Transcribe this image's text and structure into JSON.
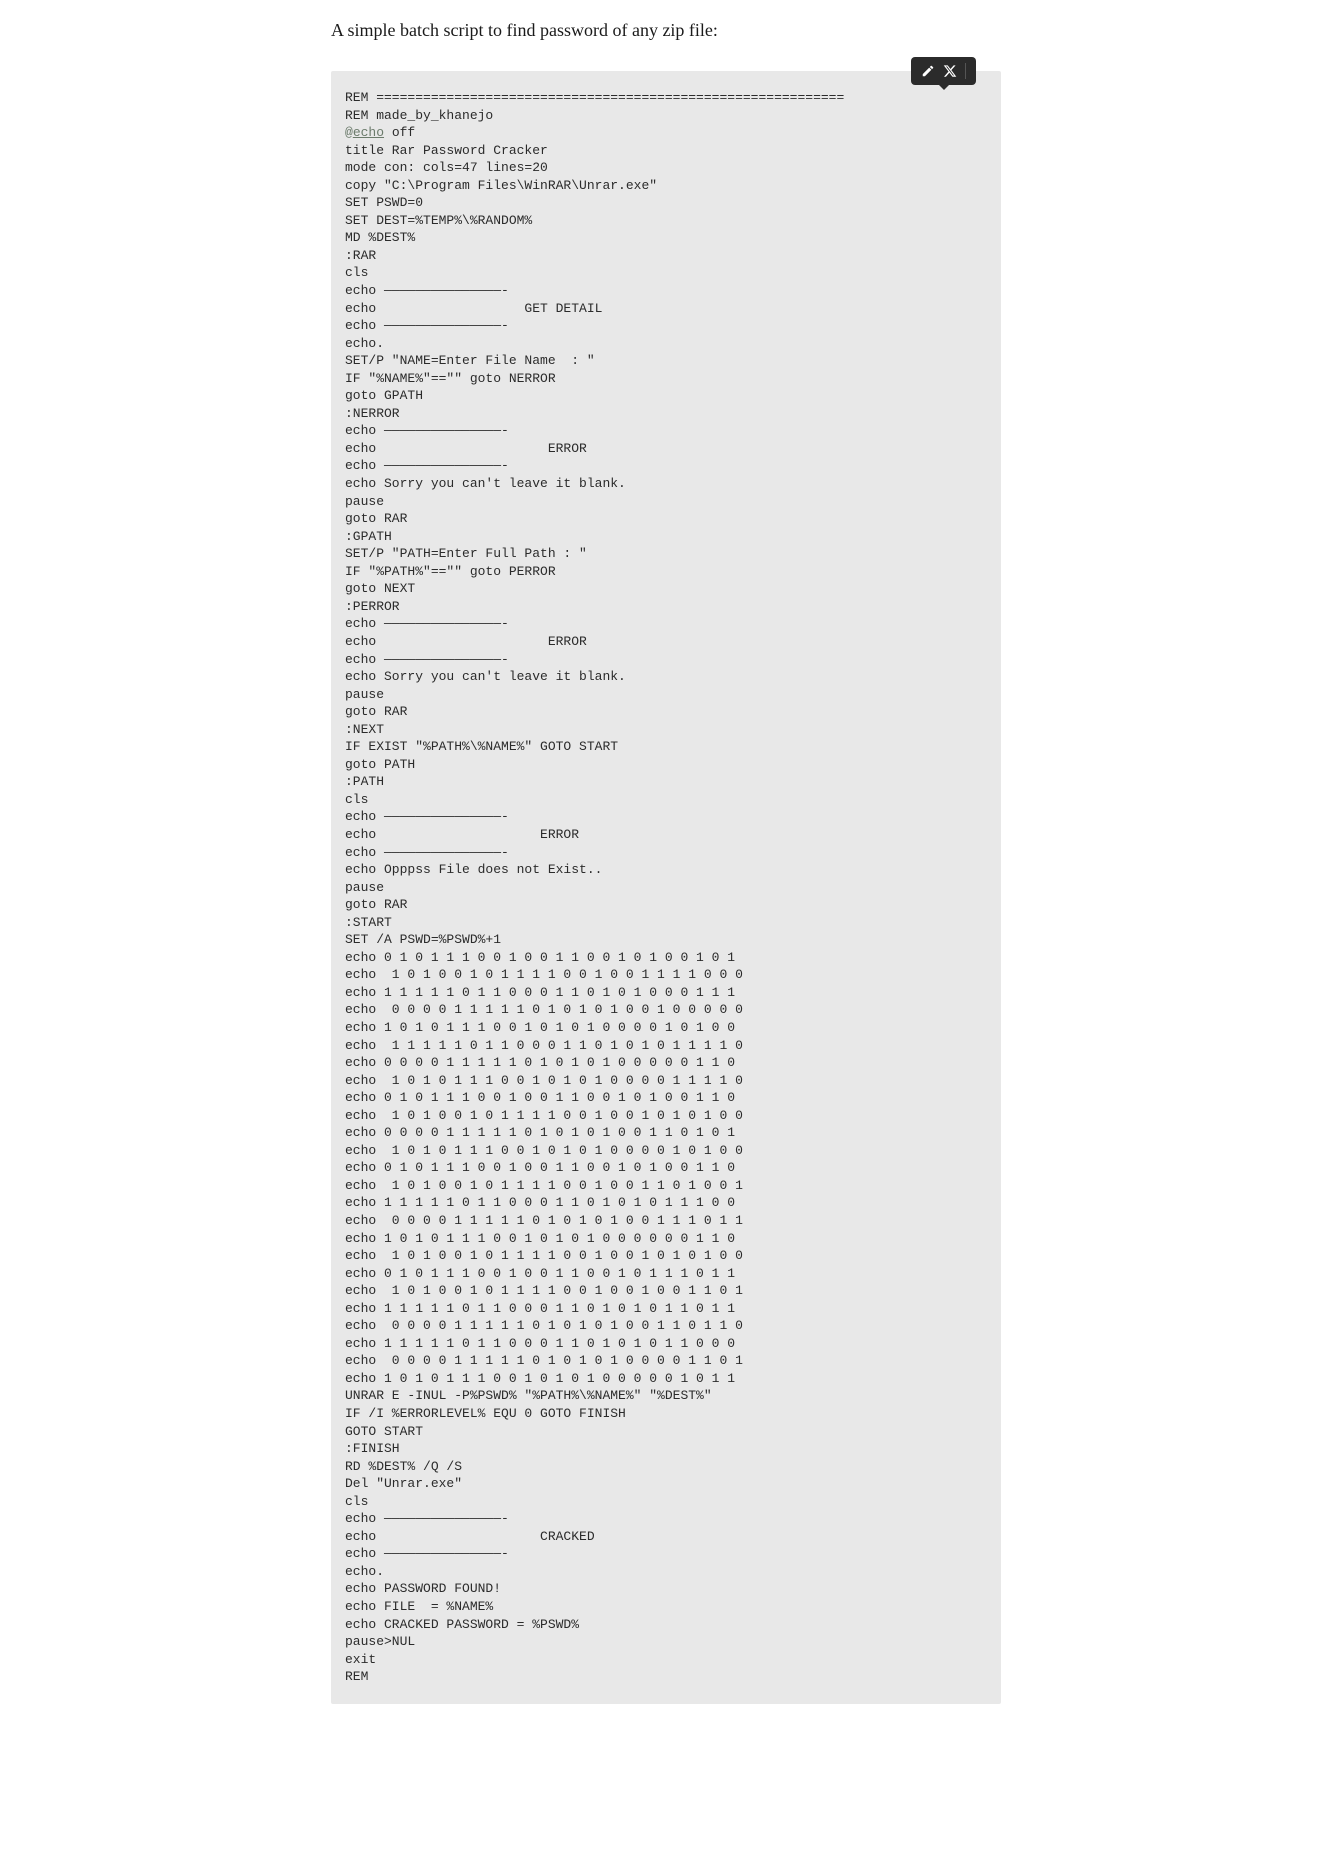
{
  "heading": "A simple batch script to find password of any zip file:",
  "mention_prefix": "@",
  "mention_text": "echo",
  "code_part1": "REM ============================================================\nREM made_by_khanejo\n",
  "code_part2": " off\ntitle Rar Password Cracker\nmode con: cols=47 lines=20\ncopy \"C:\\Program Files\\WinRAR\\Unrar.exe\"\nSET PSWD=0\nSET DEST=%TEMP%\\%RANDOM%\nMD %DEST%\n:RAR\ncls\necho ———————————————-\necho                   GET DETAIL\necho ———————————————-\necho.\nSET/P \"NAME=Enter File Name  : \"\nIF \"%NAME%\"==\"\" goto NERROR\ngoto GPATH\n:NERROR\necho ———————————————-\necho                      ERROR\necho ———————————————-\necho Sorry you can't leave it blank.\npause\ngoto RAR\n:GPATH\nSET/P \"PATH=Enter Full Path : \"\nIF \"%PATH%\"==\"\" goto PERROR\ngoto NEXT\n:PERROR\necho ———————————————-\necho                      ERROR\necho ———————————————-\necho Sorry you can't leave it blank.\npause\ngoto RAR\n:NEXT\nIF EXIST \"%PATH%\\%NAME%\" GOTO START\ngoto PATH\n:PATH\ncls\necho ———————————————-\necho                     ERROR\necho ———————————————-\necho Opppss File does not Exist..\npause\ngoto RAR\n:START\nSET /A PSWD=%PSWD%+1\necho 0 1 0 1 1 1 0 0 1 0 0 1 1 0 0 1 0 1 0 0 1 0 1\necho  1 0 1 0 0 1 0 1 1 1 1 0 0 1 0 0 1 1 1 1 0 0 0\necho 1 1 1 1 1 0 1 1 0 0 0 1 1 0 1 0 1 0 0 0 1 1 1\necho  0 0 0 0 1 1 1 1 1 0 1 0 1 0 1 0 0 1 0 0 0 0 0\necho 1 0 1 0 1 1 1 0 0 1 0 1 0 1 0 0 0 0 1 0 1 0 0\necho  1 1 1 1 1 0 1 1 0 0 0 1 1 0 1 0 1 0 1 1 1 1 0\necho 0 0 0 0 1 1 1 1 1 0 1 0 1 0 1 0 0 0 0 0 1 1 0\necho  1 0 1 0 1 1 1 0 0 1 0 1 0 1 0 0 0 0 1 1 1 1 0\necho 0 1 0 1 1 1 0 0 1 0 0 1 1 0 0 1 0 1 0 0 1 1 0\necho  1 0 1 0 0 1 0 1 1 1 1 0 0 1 0 0 1 0 1 0 1 0 0\necho 0 0 0 0 1 1 1 1 1 0 1 0 1 0 1 0 0 1 1 0 1 0 1\necho  1 0 1 0 1 1 1 0 0 1 0 1 0 1 0 0 0 0 1 0 1 0 0\necho 0 1 0 1 1 1 0 0 1 0 0 1 1 0 0 1 0 1 0 0 1 1 0\necho  1 0 1 0 0 1 0 1 1 1 1 0 0 1 0 0 1 1 0 1 0 0 1\necho 1 1 1 1 1 0 1 1 0 0 0 1 1 0 1 0 1 0 1 1 1 0 0\necho  0 0 0 0 1 1 1 1 1 0 1 0 1 0 1 0 0 1 1 1 0 1 1\necho 1 0 1 0 1 1 1 0 0 1 0 1 0 1 0 0 0 0 0 0 1 1 0\necho  1 0 1 0 0 1 0 1 1 1 1 0 0 1 0 0 1 0 1 0 1 0 0\necho 0 1 0 1 1 1 0 0 1 0 0 1 1 0 0 1 0 1 1 1 0 1 1\necho  1 0 1 0 0 1 0 1 1 1 1 0 0 1 0 0 1 0 0 1 1 0 1\necho 1 1 1 1 1 0 1 1 0 0 0 1 1 0 1 0 1 0 1 1 0 1 1\necho  0 0 0 0 1 1 1 1 1 0 1 0 1 0 1 0 0 1 1 0 1 1 0\necho 1 1 1 1 1 0 1 1 0 0 0 1 1 0 1 0 1 0 1 1 0 0 0\necho  0 0 0 0 1 1 1 1 1 0 1 0 1 0 1 0 0 0 0 1 1 0 1\necho 1 0 1 0 1 1 1 0 0 1 0 1 0 1 0 0 0 0 0 1 0 1 1\nUNRAR E -INUL -P%PSWD% \"%PATH%\\%NAME%\" \"%DEST%\"\nIF /I %ERRORLEVEL% EQU 0 GOTO FINISH\nGOTO START\n:FINISH\nRD %DEST% /Q /S\nDel \"Unrar.exe\"\ncls\necho ———————————————-\necho                     CRACKED\necho ———————————————-\necho.\necho PASSWORD FOUND!\necho FILE  = %NAME%\necho CRACKED PASSWORD = %PSWD%\npause>NUL\nexit\nREM"
}
